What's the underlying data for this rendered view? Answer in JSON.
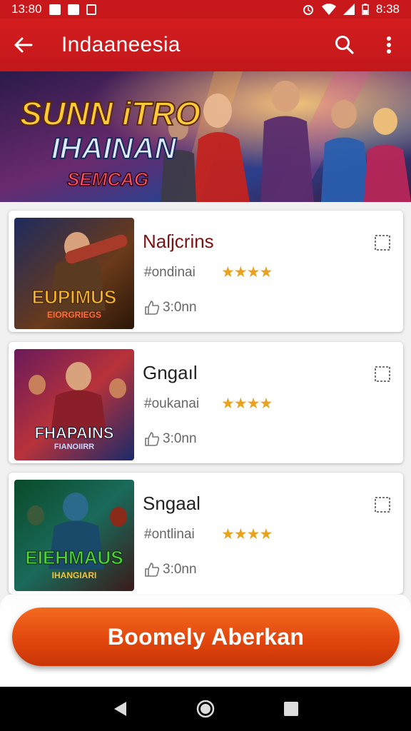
{
  "status_bar": {
    "time_left": "13:80",
    "time_right": "8:38"
  },
  "app_bar": {
    "title": "Indaaneesia"
  },
  "banner": {
    "line1": "SUNN iTRO",
    "line2": "IHAINAN",
    "line3": "SEMCAG"
  },
  "games": [
    {
      "title": "Naſjcrins",
      "genre": "#ondinai",
      "rating": "★★★★",
      "meta": "3:0nn",
      "thumb_text": "EUPIMUS",
      "thumb_sub": "EIORGRIEGS"
    },
    {
      "title": "Gngaıl",
      "genre": "#oukanai",
      "rating": "★★★★",
      "meta": "3:0nn",
      "thumb_text": "FHAPAINS",
      "thumb_sub": "FIANOIIRR"
    },
    {
      "title": "Sngaal",
      "genre": "#ontlinai",
      "rating": "★★★★",
      "meta": "3:0nn",
      "thumb_text": "EIEHMAUS",
      "thumb_sub": "IHANGIARI"
    }
  ],
  "cta": {
    "label": "Boomely Aberkan"
  },
  "colors": {
    "primary": "#c8181b",
    "cta": "#e2470e",
    "star": "#e8a21f"
  },
  "icons": [
    "back-arrow-icon",
    "search-icon",
    "more-vert-icon",
    "share-icon",
    "like-icon",
    "nav-back-icon",
    "nav-home-icon",
    "nav-recents-icon"
  ]
}
